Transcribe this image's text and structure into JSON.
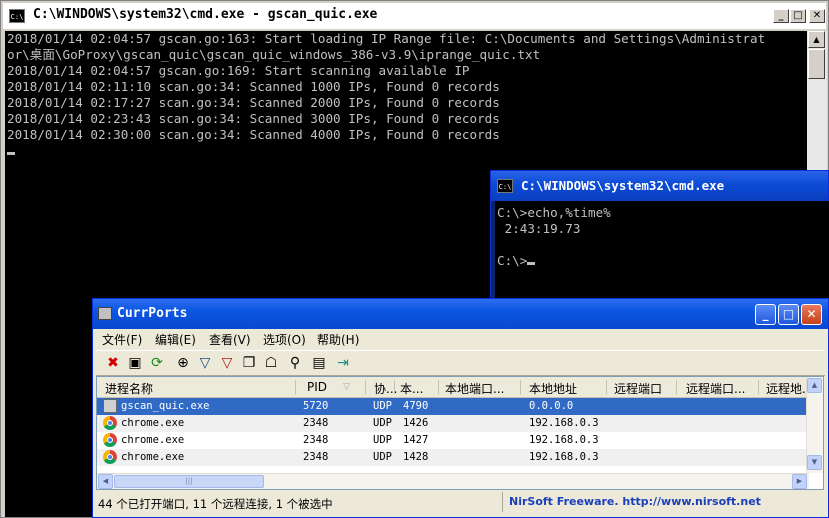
{
  "cmd_main": {
    "title": "C:\\WINDOWS\\system32\\cmd.exe - gscan_quic.exe",
    "icon_label": "C:\\",
    "lines": [
      "2018/01/14 02:04:57 gscan.go:163: Start loading IP Range file: C:\\Documents and Settings\\Administrat",
      "or\\桌面\\GoProxy\\gscan_quic\\gscan_quic_windows_386-v3.9\\iprange_quic.txt",
      "2018/01/14 02:04:57 gscan.go:169: Start scanning available IP",
      "2018/01/14 02:11:10 scan.go:34: Scanned 1000 IPs, Found 0 records",
      "2018/01/14 02:17:27 scan.go:34: Scanned 2000 IPs, Found 0 records",
      "2018/01/14 02:23:43 scan.go:34: Scanned 3000 IPs, Found 0 records",
      "2018/01/14 02:30:00 scan.go:34: Scanned 4000 IPs, Found 0 records"
    ]
  },
  "cmd_second": {
    "title": "C:\\WINDOWS\\system32\\cmd.exe",
    "icon_label": "C:\\",
    "lines": [
      "C:\\>echo,%time%",
      " 2:43:19.73",
      "",
      "C:\\>"
    ]
  },
  "currports": {
    "title": "CurrPorts",
    "menu": [
      "文件(F)",
      "编辑(E)",
      "查看(V)",
      "选项(O)",
      "帮助(H)"
    ],
    "columns": [
      "进程名称",
      "PID",
      "协...",
      "本...",
      "本地端口...",
      "本地地址",
      "远程端口",
      "远程端口...",
      "远程地..."
    ],
    "rows": [
      {
        "process": "gscan_quic.exe",
        "pid": "5720",
        "protocol": "UDP",
        "local_port": "4790",
        "local_address": "0.0.0.0",
        "selected": true,
        "icon": "app-icon"
      },
      {
        "process": "chrome.exe",
        "pid": "2348",
        "protocol": "UDP",
        "local_port": "1426",
        "local_address": "192.168.0.3",
        "selected": false,
        "icon": "chrome-icon"
      },
      {
        "process": "chrome.exe",
        "pid": "2348",
        "protocol": "UDP",
        "local_port": "1427",
        "local_address": "192.168.0.3",
        "selected": false,
        "icon": "chrome-icon"
      },
      {
        "process": "chrome.exe",
        "pid": "2348",
        "protocol": "UDP",
        "local_port": "1428",
        "local_address": "192.168.0.3",
        "selected": false,
        "icon": "chrome-icon"
      }
    ],
    "status_left": "44 个已打开端口, 11 个远程连接, 1 个被选中",
    "status_right": "NirSoft Freeware.  http://www.nirsoft.net"
  },
  "colors": {
    "console_bg": "#000000",
    "console_fg": "#c0c0c0",
    "selection": "#316ac5",
    "xp_title_blue": "#0a48cf",
    "nirsoft_link": "#1a3fb8"
  }
}
